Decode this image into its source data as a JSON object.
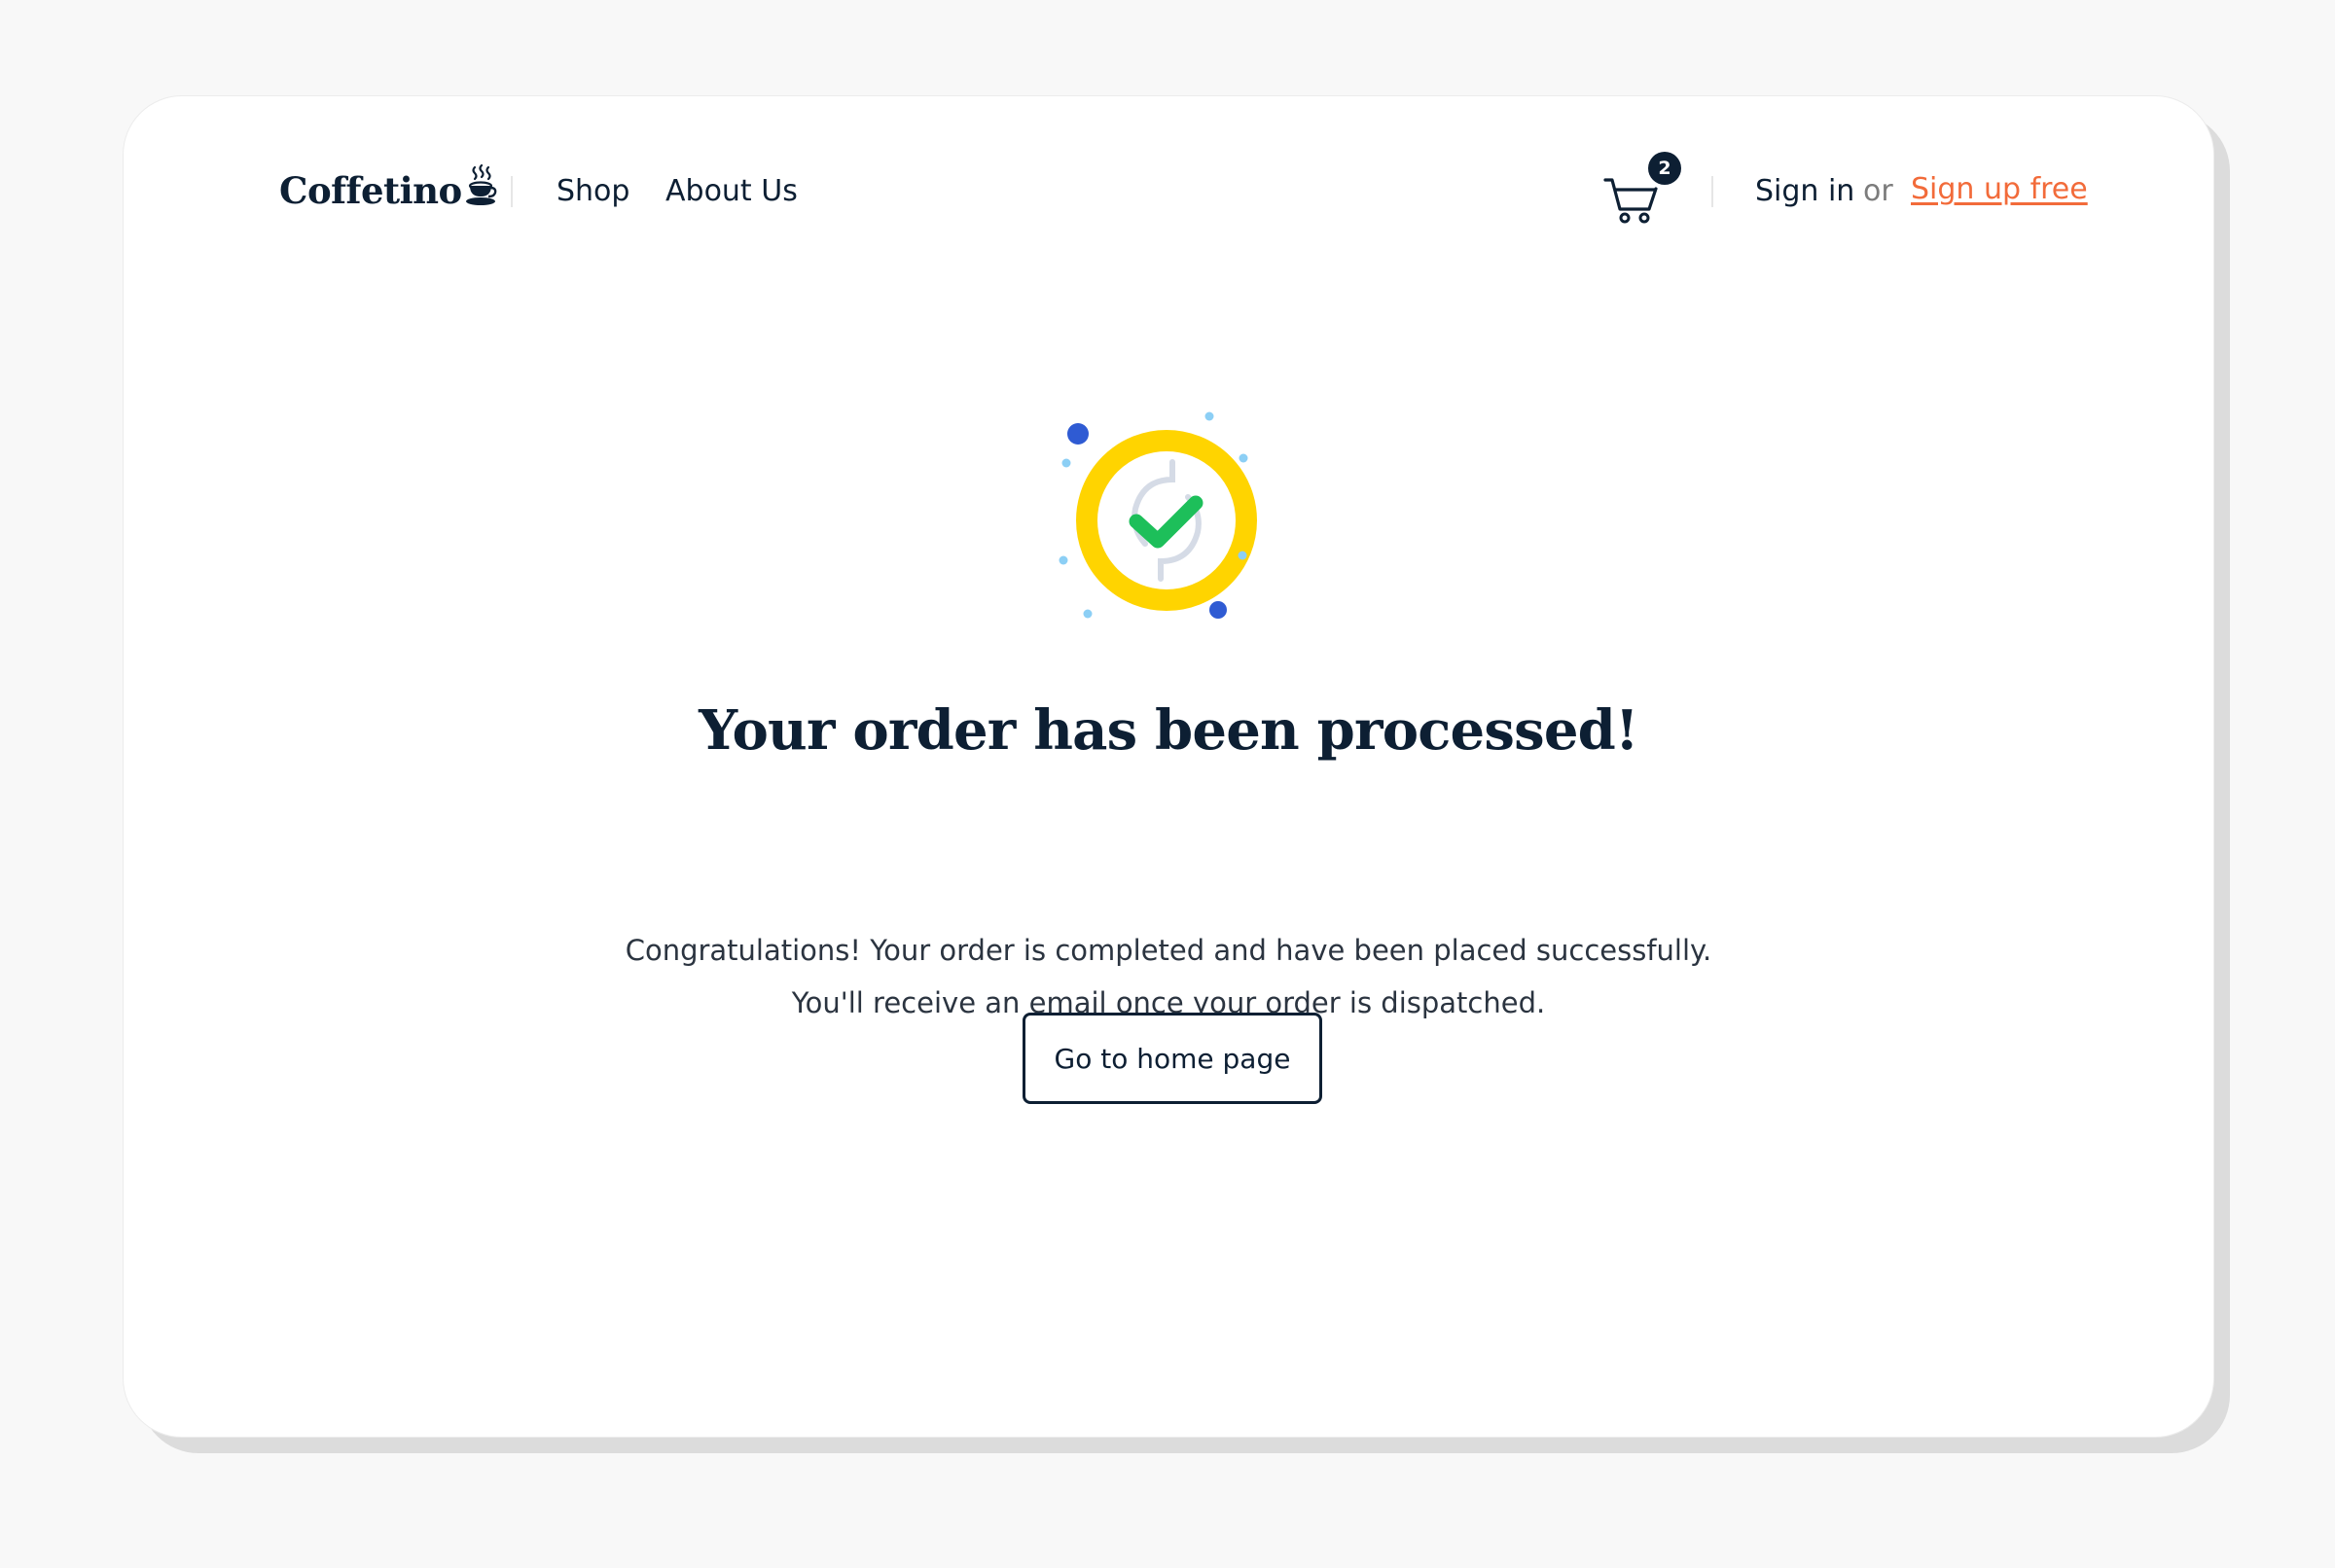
{
  "header": {
    "logo_text": "Coffetino",
    "nav": {
      "shop": "Shop",
      "about": "About Us"
    },
    "cart": {
      "count": "2",
      "icon": "cart-icon"
    },
    "auth": {
      "sign_in": "Sign in",
      "or": "or",
      "sign_up": "Sign up free"
    }
  },
  "main": {
    "illustration_icon": "success-check-badge-icon",
    "title": "Your order has been processed!",
    "message_line1": "Congratulations! Your order is completed and have been placed successfully.",
    "message_line2": "You'll receive an email once your order is dispatched.",
    "button_label": "Go to home page"
  },
  "colors": {
    "page_background": "#f8f8f8",
    "card_background": "#ffffff",
    "text_primary": "#0d1f33",
    "accent_link": "#f26b3a",
    "badge_ring": "#ffd400",
    "check_green": "#1dbf5a",
    "dot_blue": "#2f5bd3",
    "dot_light_blue": "#8ccff5"
  }
}
